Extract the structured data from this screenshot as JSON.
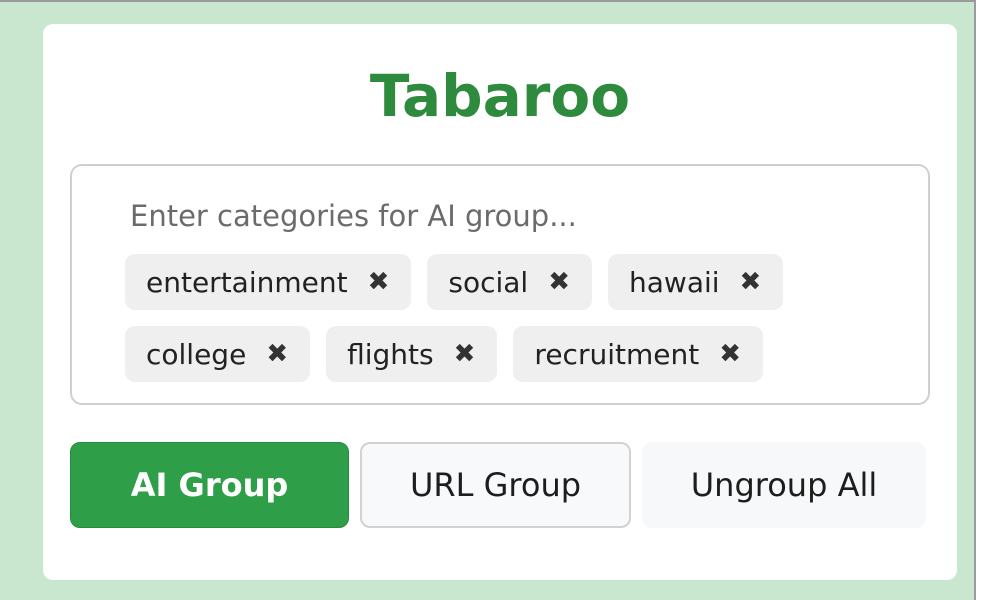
{
  "app": {
    "title": "Tabaroo"
  },
  "category_input": {
    "placeholder": "Enter categories for AI group...",
    "value": ""
  },
  "tags": [
    {
      "label": "entertainment",
      "remove_glyph": "✖"
    },
    {
      "label": "social",
      "remove_glyph": "✖"
    },
    {
      "label": "hawaii",
      "remove_glyph": "✖"
    },
    {
      "label": "college",
      "remove_glyph": "✖"
    },
    {
      "label": "flights",
      "remove_glyph": "✖"
    },
    {
      "label": "recruitment",
      "remove_glyph": "✖"
    }
  ],
  "buttons": {
    "ai_group": "AI Group",
    "url_group": "URL Group",
    "ungroup_all": "Ungroup All"
  },
  "colors": {
    "brand_green": "#2e8b3e",
    "primary_button": "#2e9e48",
    "frame_background": "#c9e6cf",
    "tag_background": "#efefef"
  },
  "icons": {
    "tag_remove": "close-icon"
  }
}
